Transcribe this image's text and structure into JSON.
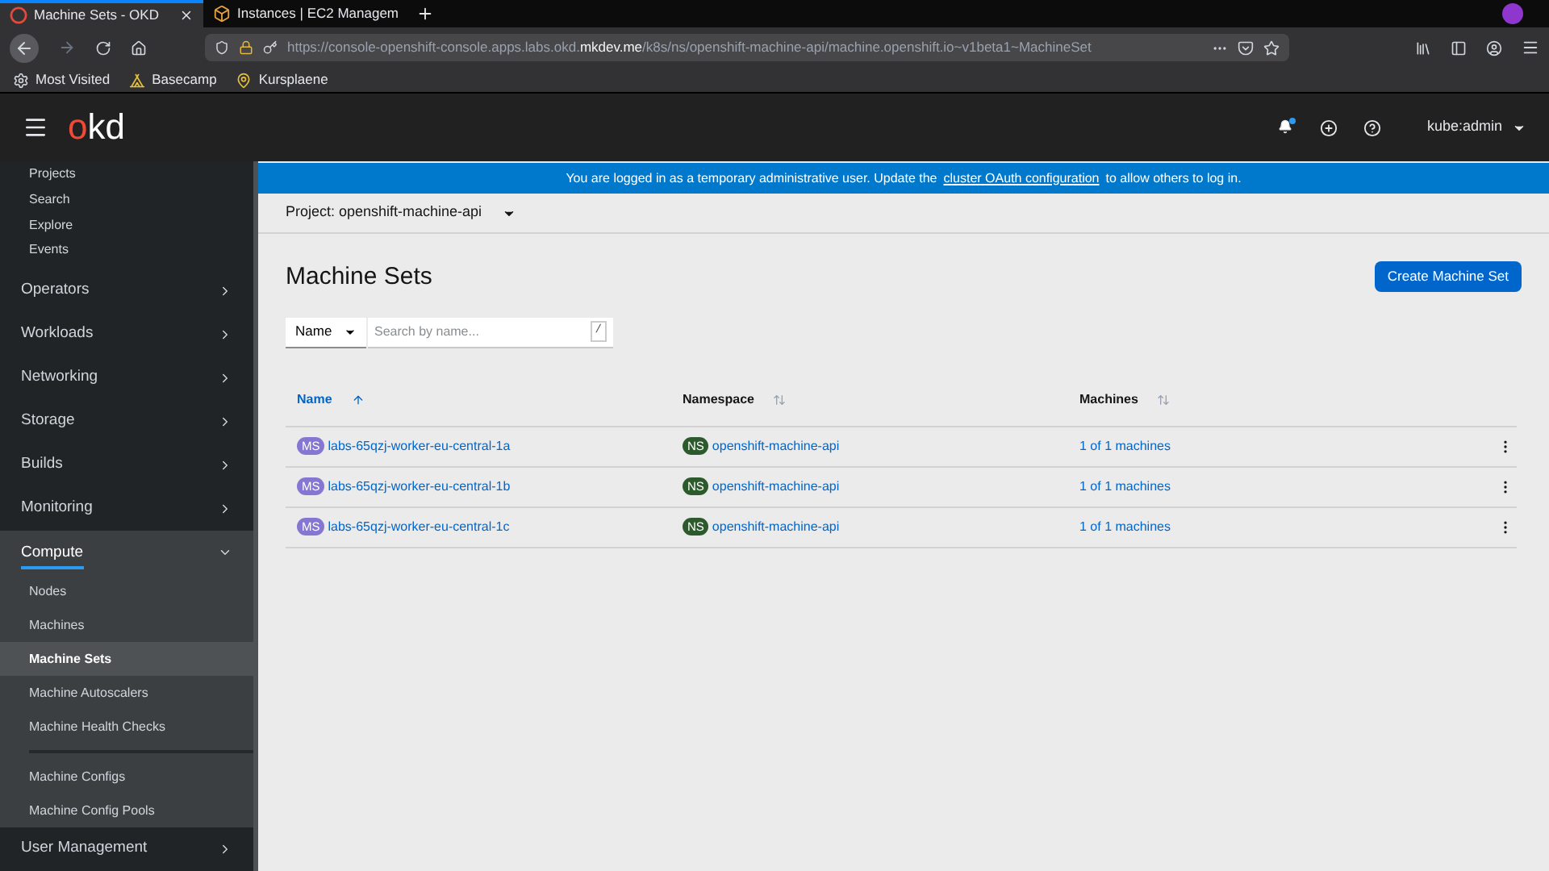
{
  "browser": {
    "tabs": [
      {
        "title": "Machine Sets - OKD",
        "selected": true,
        "kind": "okd"
      },
      {
        "title": "Instances | EC2 Managem",
        "selected": false,
        "kind": "box"
      }
    ],
    "url": {
      "prefix": "https://console-openshift-console.apps.labs.okd.",
      "domain": "mkdev.me",
      "path": "/k8s/ns/openshift-machine-api/machine.openshift.io~v1beta1~MachineSet"
    },
    "bookmarks": [
      {
        "label": "Most Visited",
        "kind": "gear"
      },
      {
        "label": "Basecamp",
        "kind": "camp"
      },
      {
        "label": "Kursplaene",
        "kind": "pin"
      }
    ]
  },
  "header": {
    "logo": "okd",
    "user": "kube:admin",
    "notification_unread": true
  },
  "sidebar": {
    "top_items": [
      {
        "label": "Projects",
        "selected": false
      },
      {
        "label": "Search",
        "selected": false
      },
      {
        "label": "Explore",
        "selected": false
      },
      {
        "label": "Events",
        "selected": false
      }
    ],
    "sections": [
      {
        "label": "Operators",
        "expanded": false
      },
      {
        "label": "Workloads",
        "expanded": false
      },
      {
        "label": "Networking",
        "expanded": false
      },
      {
        "label": "Storage",
        "expanded": false
      },
      {
        "label": "Builds",
        "expanded": false
      },
      {
        "label": "Monitoring",
        "expanded": false
      },
      {
        "label": "Compute",
        "expanded": true,
        "children": [
          {
            "label": "Nodes",
            "selected": false,
            "separated": false
          },
          {
            "label": "Machines",
            "selected": false,
            "separated": false
          },
          {
            "label": "Machine Sets",
            "selected": true,
            "separated": false
          },
          {
            "label": "Machine Autoscalers",
            "selected": false,
            "separated": false
          },
          {
            "label": "Machine Health Checks",
            "selected": false,
            "separated": false
          },
          {
            "label": "Machine Configs",
            "selected": false,
            "separated": true
          },
          {
            "label": "Machine Config Pools",
            "selected": false,
            "separated": false
          }
        ]
      },
      {
        "label": "User Management",
        "expanded": false
      }
    ]
  },
  "banner": {
    "before": "You are logged in as a temporary administrative user. Update the",
    "link": "cluster OAuth configuration",
    "after": "to allow others to log in."
  },
  "project": "Project: openshift-machine-api",
  "page_title": "Machine Sets",
  "create_button": "Create Machine Set",
  "filter": {
    "type": "Name",
    "placeholder": "Search by name...",
    "shortcut": "/"
  },
  "table": {
    "columns": [
      {
        "label": "Name",
        "sorted": true
      },
      {
        "label": "Namespace",
        "sorted": false
      },
      {
        "label": "Machines",
        "sorted": false
      }
    ],
    "rows": [
      {
        "badge": "MS",
        "name": "labs-65qzj-worker-eu-central-1a",
        "ns_badge": "NS",
        "namespace": "openshift-machine-api",
        "machines": "1 of 1 machines"
      },
      {
        "badge": "MS",
        "name": "labs-65qzj-worker-eu-central-1b",
        "ns_badge": "NS",
        "namespace": "openshift-machine-api",
        "machines": "1 of 1 machines"
      },
      {
        "badge": "MS",
        "name": "labs-65qzj-worker-eu-central-1c",
        "ns_badge": "NS",
        "namespace": "openshift-machine-api",
        "machines": "1 of 1 machines"
      }
    ]
  }
}
